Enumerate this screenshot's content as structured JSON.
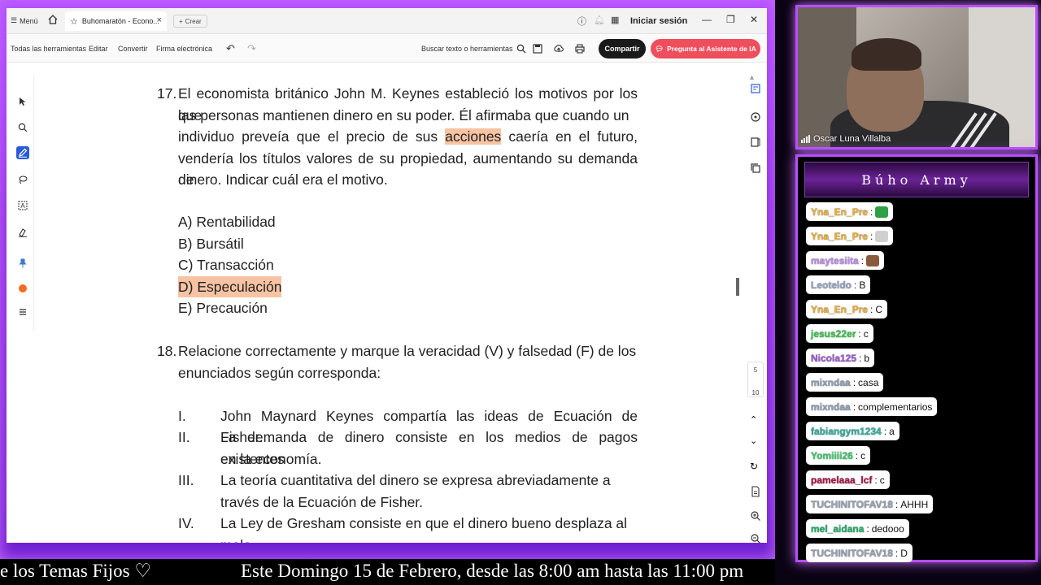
{
  "titlebar": {
    "menu_label": "Menú",
    "tab_title": "Buhomaratón - Econo...",
    "tab_close": "×",
    "new_tab_label": "Crear",
    "signin_label": "Iniciar sesión"
  },
  "toolbar": {
    "all_tools": "Todas las herramientas",
    "edit": "Editar",
    "convert": "Convertir",
    "esign": "Firma electrónica",
    "search_placeholder": "Buscar texto o herramientas",
    "share": "Compartir",
    "ai_assistant": "Pregunta al Asistente de IA"
  },
  "document": {
    "q17": {
      "number": "17.",
      "lines": [
        "El economista británico John M. Keynes estableció los motivos por los que",
        "las personas mantienen dinero en su poder. Él afirmaba que cuando un",
        "vendería los títulos valores de su propiedad, aumentando su demanda de",
        "dinero. Indicar cuál era el motivo."
      ],
      "line3_pre": "individuo preveía que el precio de sus ",
      "line3_highlight": "acciones",
      "line3_post": " caería en el futuro,",
      "options": [
        "A) Rentabilidad",
        "B) Bursátil",
        "C) Transacción",
        "D) Especulación",
        "E) Precaución"
      ],
      "highlighted_option": 3
    },
    "q18": {
      "number": "18.",
      "lines": [
        "Relacione correctamente y marque la veracidad (V) y falsedad (F) de los",
        "enunciados según corresponda:"
      ],
      "statements": [
        {
          "num": "I.",
          "lines": [
            "John Maynard Keynes compartía las ideas de Ecuación de Fisher."
          ]
        },
        {
          "num": "II.",
          "lines": [
            "La demanda de dinero consiste en los medios de pagos existentes",
            "en la economía."
          ]
        },
        {
          "num": "III.",
          "lines": [
            "La teoría cuantitativa del dinero se expresa abreviadamente a",
            "través de la Ecuación de Fisher."
          ]
        },
        {
          "num": "IV.",
          "lines": [
            "La Ley de Gresham consiste en que el dinero bueno desplaza al",
            "malo."
          ]
        }
      ]
    }
  },
  "page_indicator": {
    "current": "5",
    "total": "10"
  },
  "webcam": {
    "name": "Oscar Luna Villalba"
  },
  "chat": {
    "title": "Búho Army",
    "messages": [
      {
        "user": "Yna_En_Pre",
        "text": "",
        "color": "#f2b134",
        "emote": "#2ea043"
      },
      {
        "user": "Yna_En_Pre",
        "text": "",
        "color": "#f2b134",
        "emote": "#cfcfcf"
      },
      {
        "user": "maytesiita",
        "text": "",
        "color": "#c38cf0",
        "emote": "#8a5a3c"
      },
      {
        "user": "Leoteldo",
        "text": "B",
        "color": "#9aa8c7",
        "emote": ""
      },
      {
        "user": "Yna_En_Pre",
        "text": "C",
        "color": "#f2b134",
        "emote": ""
      },
      {
        "user": "jesus22er",
        "text": "c",
        "color": "#38c94a",
        "emote": ""
      },
      {
        "user": "Nicola125",
        "text": "b",
        "color": "#a35bd9",
        "emote": ""
      },
      {
        "user": "mixndaa",
        "text": "casa",
        "color": "#8fa0b8",
        "emote": ""
      },
      {
        "user": "mixndaa",
        "text": "complementarios",
        "color": "#8fa0b8",
        "emote": ""
      },
      {
        "user": "fabiangym1234",
        "text": "a",
        "color": "#2fb3a2",
        "emote": ""
      },
      {
        "user": "Yomiiii26",
        "text": "c",
        "color": "#3ccf6a",
        "emote": ""
      },
      {
        "user": "pamelaaa_lcf",
        "text": "c",
        "color": "#b2124a",
        "emote": ""
      },
      {
        "user": "TUCHINITOFAV18",
        "text": "AHHH",
        "color": "#9aa4b6",
        "emote": ""
      },
      {
        "user": "mel_aidana",
        "text": "dedooo",
        "color": "#1fb36b",
        "emote": ""
      },
      {
        "user": "TUCHINITOFAV18",
        "text": "D",
        "color": "#9aa4b6",
        "emote": ""
      }
    ]
  },
  "ticker": {
    "left_text": "e los Temas Fijos ♡",
    "right_text": "Este Domingo 15 de Febrero, desde las 8:00 am hasta las 11:00 pm"
  }
}
